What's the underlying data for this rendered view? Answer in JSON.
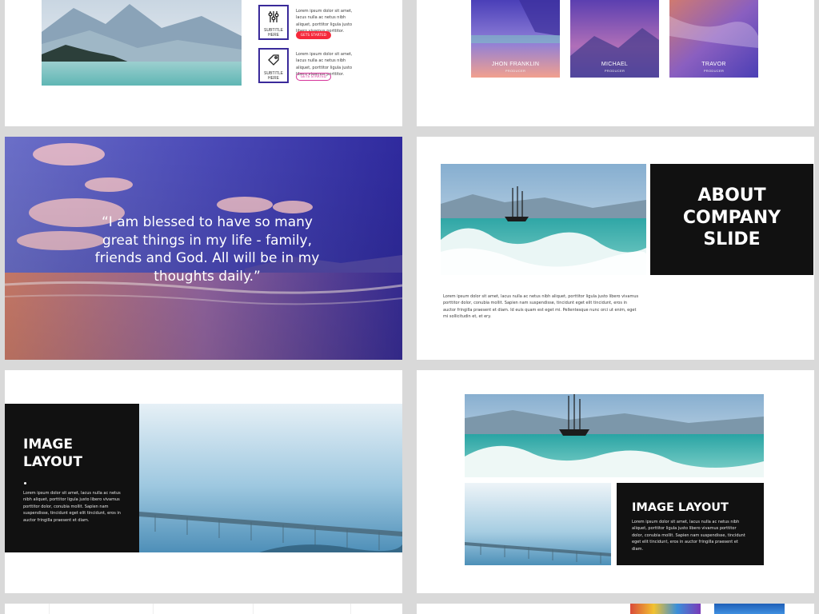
{
  "slide1": {
    "items": [
      {
        "subtitle": "SUBTITLE HERE",
        "icon": "sliders-icon",
        "text": "Lorem ipsum dolor sit amet, lacus nulla ac netus nibh aliquet, porttitor ligula justo libero vivamus porttitor.",
        "button": "GETS STARTED",
        "button_style": "filled"
      },
      {
        "subtitle": "SUBTITLE HERE",
        "icon": "tag-icon",
        "text": "Lorem ipsum dolor sit amet, lacus nulla ac netus nibh aliquet, porttitor ligula justo libero vivamus porttitor.",
        "button": "GETS STARTED",
        "button_style": "outline"
      }
    ]
  },
  "slide2": {
    "members": [
      {
        "name": "JHON FRANKLIN",
        "role": "PRODUCER"
      },
      {
        "name": "MICHAEL",
        "role": "PRODUCER"
      },
      {
        "name": "TRAVOR",
        "role": "PRODUCER"
      }
    ]
  },
  "slide3": {
    "quote": "“I am blessed to have so many great things in my life - family, friends and God. All will be in my thoughts daily.”"
  },
  "slide4": {
    "title": "ABOUT COMPANY SLIDE",
    "body": "Lorem ipsum dolor sit amet, lacus nulla ac netus nibh aliquet, porttitor ligula justo libero vivamus porttitor dolor, conubia mollit. Sapien nam suspendisse, tincidunt eget elit tincidunt, eros in auctor fringilla praesent et diam. Id euis quam est eget mi. Pellentesque nunc orci ut enim, eget mi sollicitudin et, et ery."
  },
  "slide5": {
    "title": "IMAGE LAYOUT",
    "body": "Lorem ipsum dolor sit amet, lacus nulla ac netus nibh aliquet, porttitor ligula justo libero vivamus porttitor dolor, conubia mollit. Sapien nam suspendisse, tincidunt eget elit tincidunt, eros in auctor fringilla praesent et diam."
  },
  "slide6": {
    "title": "IMAGE LAYOUT",
    "body": "Lorem ipsum dolor sit amet, lacus nulla ac netus nibh aliquet, porttitor ligula justo libero vivamus porttitor dolor, conubia mollit. Sapien nam suspendisse, tincidunt eget elit tincidunt, eros in auctor fringilla praesent et diam."
  },
  "colors": {
    "page_bg": "#d9d9d9",
    "dark_panel": "#111111",
    "accent_red": "#f5293b",
    "accent_purple": "#3a2a9a",
    "accent_pink": "#d6339a"
  }
}
